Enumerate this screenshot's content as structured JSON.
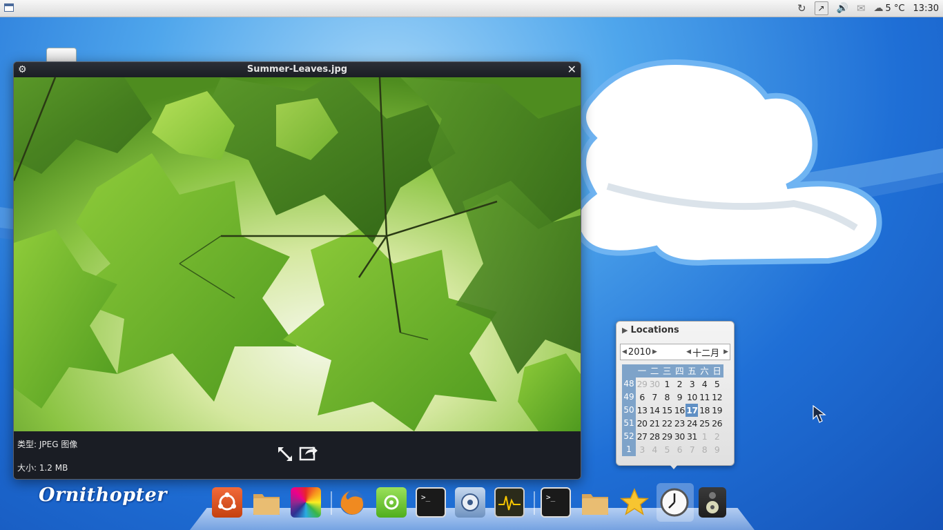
{
  "top_panel": {
    "weather_temp": "5 °C",
    "clock": "13:30",
    "tray_icons": [
      "updates-icon",
      "network-icon",
      "volume-icon",
      "mail-icon",
      "weather-icon"
    ]
  },
  "viewer": {
    "title": "Summer-Leaves.jpg",
    "type_line": "类型: JPEG 图像",
    "size_line": "大小: 1.2 MB"
  },
  "calendar": {
    "locations_label": "Locations",
    "year": "2010",
    "month": "十二月",
    "weekday_headers": [
      "一",
      "二",
      "三",
      "四",
      "五",
      "六",
      "日"
    ],
    "weeks": [
      {
        "wk": "48",
        "days": [
          "29",
          "30",
          "1",
          "2",
          "3",
          "4",
          "5"
        ]
      },
      {
        "wk": "49",
        "days": [
          "6",
          "7",
          "8",
          "9",
          "10",
          "11",
          "12"
        ]
      },
      {
        "wk": "50",
        "days": [
          "13",
          "14",
          "15",
          "16",
          "17",
          "18",
          "19"
        ]
      },
      {
        "wk": "51",
        "days": [
          "20",
          "21",
          "22",
          "23",
          "24",
          "25",
          "26"
        ]
      },
      {
        "wk": "52",
        "days": [
          "27",
          "28",
          "29",
          "30",
          "31",
          "1",
          "2"
        ]
      },
      {
        "wk": "1",
        "days": [
          "3",
          "4",
          "5",
          "6",
          "7",
          "8",
          "9"
        ]
      }
    ],
    "today": "17"
  },
  "desktop": {
    "logo_text": "Ornithopter"
  },
  "dock": {
    "items": [
      "ubuntu-icon",
      "home-folder-icon",
      "color-palette-icon",
      "firefox-icon",
      "software-center-icon",
      "terminal-icon",
      "disk-utility-icon",
      "system-monitor-icon",
      "terminal-icon",
      "folder-icon",
      "favorites-star-icon",
      "clock-icon",
      "speaker-icon"
    ]
  },
  "colors": {
    "desktop_blue": "#1f6fd6",
    "viewer_bg": "#16191f",
    "calendar_accent": "#7ea3c9",
    "today_highlight": "#5f8fc4"
  }
}
